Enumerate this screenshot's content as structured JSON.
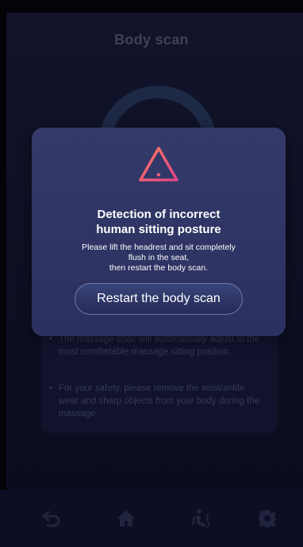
{
  "screen": {
    "title": "Body scan"
  },
  "info_card": {
    "tips": [
      "The massage chair will automatically adjust to the most comfortable massage sitting position.",
      "For your safety, please remove the wrist/ankle wear and sharp objects from your body during the massage."
    ],
    "bullet": "•"
  },
  "dialog": {
    "icon": "warning-triangle-icon",
    "title_line1": "Detection of incorrect",
    "title_line2": "human sitting posture",
    "body_line1": "Please lift the headrest and sit completely",
    "body_line2": "flush in the seat,",
    "body_line3": "then restart the body scan.",
    "button_label": "Restart the body scan"
  },
  "bottom_nav": {
    "items": [
      {
        "icon": "back-arrow-icon"
      },
      {
        "icon": "home-icon"
      },
      {
        "icon": "massage-mode-icon"
      },
      {
        "icon": "gear-icon"
      }
    ]
  },
  "colors": {
    "background": "#171a38",
    "dialog": "#343a69",
    "warning_gradient_start": "#ff7a5c",
    "warning_gradient_end": "#e0448a",
    "button_border": "#6f7aa8",
    "inactive_icon": "#2e3354"
  }
}
